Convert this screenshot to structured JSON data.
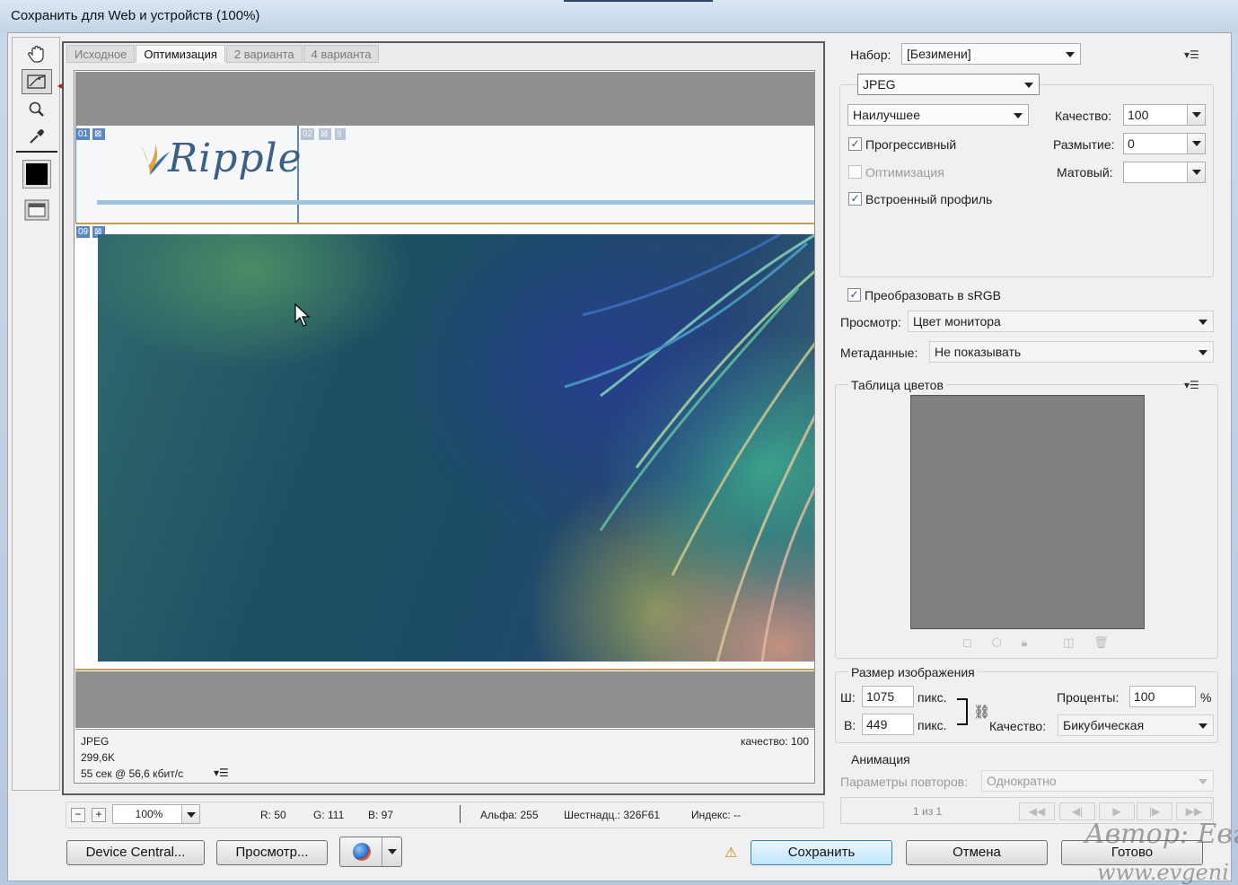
{
  "window": {
    "title": "Сохранить для Web и устройств (100%)"
  },
  "tabs": [
    "Исходное",
    "Оптимизация",
    "2 варианта",
    "4 варианта"
  ],
  "slices": {
    "s1": "01",
    "s2": "02",
    "s3": "09"
  },
  "logo_text": "Ripple",
  "info": {
    "format": "JPEG",
    "size": "299,6K",
    "time": "55 сек @ 56,6 кбит/с",
    "quality": "качество: 100"
  },
  "panel": {
    "preset_label": "Набор:",
    "preset_value": "[Безимени]",
    "format": "JPEG",
    "quality_preset": "Наилучшее",
    "quality_label": "Качество:",
    "quality_value": "100",
    "blur_label": "Размытие:",
    "blur_value": "0",
    "matte_label": "Матовый:",
    "progressive": "Прогрессивный",
    "optimized": "Оптимизация",
    "embed_profile": "Встроенный профиль",
    "convert_srgb": "Преобразовать в sRGB",
    "preview_label": "Просмотр:",
    "preview_value": "Цвет монитора",
    "metadata_label": "Метаданные:",
    "metadata_value": "Не показывать",
    "color_table_label": "Таблица цветов",
    "image_size_label": "Размер изображения",
    "width_label": "Ш:",
    "width_value": "1075",
    "height_label": "В:",
    "height_value": "449",
    "px": "пикс.",
    "percent_label": "Проценты:",
    "percent_value": "100",
    "percent_sign": "%",
    "resample_label": "Качество:",
    "resample_value": "Бикубическая",
    "animation_label": "Анимация",
    "loop_label": "Параметры повторов:",
    "loop_value": "Однократно",
    "frame_counter": "1 из 1"
  },
  "status": {
    "zoom": "100%",
    "r": "R: 50",
    "g": "G: 111",
    "b": "B: 97",
    "alpha": "Альфа: 255",
    "hex": "Шестнадц.: 326F61",
    "index": "Индекс: --"
  },
  "buttons": {
    "device_central": "Device Central...",
    "preview": "Просмотр...",
    "save": "Сохранить",
    "cancel": "Отмена",
    "done": "Готово"
  },
  "watermark": {
    "line1": "Автор: Евг",
    "line2": "www.evgeni"
  },
  "colors": {
    "accent_red": "#cc1010",
    "slice_blue": "#5b88c4",
    "canvas_gray": "#8f8f8f"
  }
}
